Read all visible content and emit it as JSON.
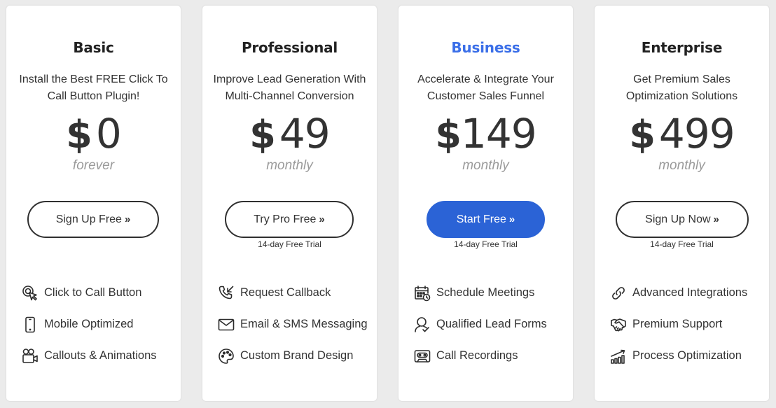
{
  "plans": [
    {
      "name": "Basic",
      "description": "Install the Best FREE Click To Call Button Plugin!",
      "currency": "$",
      "price": "0",
      "period": "forever",
      "button_label": "Sign Up Free",
      "button_icon": "double-chevron-right-icon",
      "trial_note": "",
      "features": [
        {
          "icon": "click-pointer-icon",
          "label": "Click to Call Button"
        },
        {
          "icon": "mobile-phone-icon",
          "label": "Mobile Optimized"
        },
        {
          "icon": "video-camera-icon",
          "label": "Callouts & Animations"
        }
      ]
    },
    {
      "name": "Professional",
      "description": "Improve Lead Generation With Multi-Channel Conversion",
      "currency": "$",
      "price": "49",
      "period": "monthly",
      "button_label": "Try Pro Free",
      "button_icon": "double-chevron-right-icon",
      "trial_note": "14-day Free Trial",
      "features": [
        {
          "icon": "phone-incoming-icon",
          "label": "Request Callback"
        },
        {
          "icon": "envelope-icon",
          "label": "Email & SMS Messaging"
        },
        {
          "icon": "palette-icon",
          "label": "Custom Brand Design"
        }
      ]
    },
    {
      "name": "Business",
      "description": "Accelerate & Integrate Your Customer Sales Funnel",
      "currency": "$",
      "price": "149",
      "period": "monthly",
      "button_label": "Start Free",
      "button_icon": "double-chevron-right-icon",
      "trial_note": "14-day Free Trial",
      "highlighted": true,
      "features": [
        {
          "icon": "calendar-clock-icon",
          "label": "Schedule Meetings"
        },
        {
          "icon": "user-check-icon",
          "label": "Qualified Lead Forms"
        },
        {
          "icon": "cassette-icon",
          "label": "Call Recordings"
        }
      ]
    },
    {
      "name": "Enterprise",
      "description": "Get Premium Sales Optimization Solutions",
      "currency": "$",
      "price": "499",
      "period": "monthly",
      "button_label": "Sign Up Now",
      "button_icon": "double-chevron-right-icon",
      "trial_note": "14-day Free Trial",
      "features": [
        {
          "icon": "link-icon",
          "label": "Advanced Integrations"
        },
        {
          "icon": "handshake-icon",
          "label": "Premium Support"
        },
        {
          "icon": "growth-chart-icon",
          "label": "Process Optimization"
        }
      ]
    }
  ],
  "colors": {
    "accent": "#3b6fe8",
    "primary_button": "#2b63d6",
    "background": "#ebebeb",
    "card": "#ffffff",
    "text": "#2b2b2b",
    "muted": "#9a9a9a"
  }
}
